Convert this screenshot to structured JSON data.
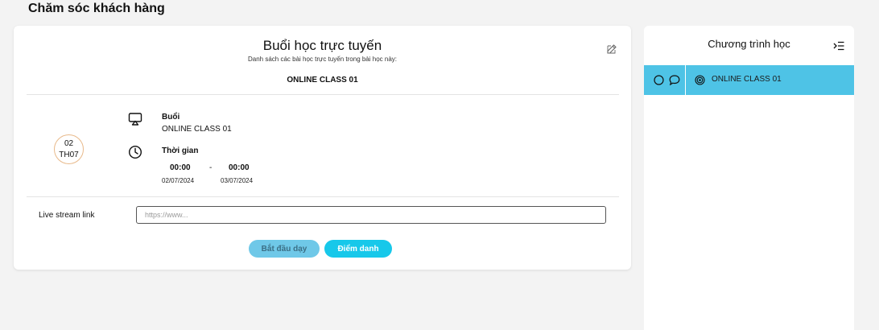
{
  "page": {
    "title": "Chăm sóc khách hàng"
  },
  "card": {
    "title": "Buổi học trực tuyến",
    "subtitle": "Danh sách các bài học trực tuyến trong bài học này:",
    "class_name": "ONLINE CLASS 01",
    "edit_icon": "edit-icon"
  },
  "date_badge": {
    "day": "02",
    "month": "TH07"
  },
  "session": {
    "icon": "cast-icon",
    "label": "Buổi",
    "value": "ONLINE CLASS 01"
  },
  "time": {
    "icon": "clock-icon",
    "label": "Thời gian",
    "start_time": "00:00",
    "end_time": "00:00",
    "separator": "-",
    "start_date": "02/07/2024",
    "end_date": "03/07/2024"
  },
  "livestream": {
    "label": "Live stream link",
    "value": "",
    "placeholder": "https://www..."
  },
  "buttons": {
    "start_label": "Bắt đầu dạy",
    "attendance_label": "Điểm danh"
  },
  "sidebar": {
    "title": "Chương trình học",
    "collapse_icon": "menu-collapse-icon",
    "items": [
      {
        "label": "ONLINE CLASS 01",
        "icons": [
          "circle-icon",
          "comment-icon",
          "target-icon"
        ]
      }
    ]
  },
  "colors": {
    "accent_cyan": "#17c8ea",
    "start_button": "#6fc8e8",
    "sidebar_active": "#4ec3e6",
    "date_ring": "#e8b98a",
    "background": "#f3f3f3"
  }
}
